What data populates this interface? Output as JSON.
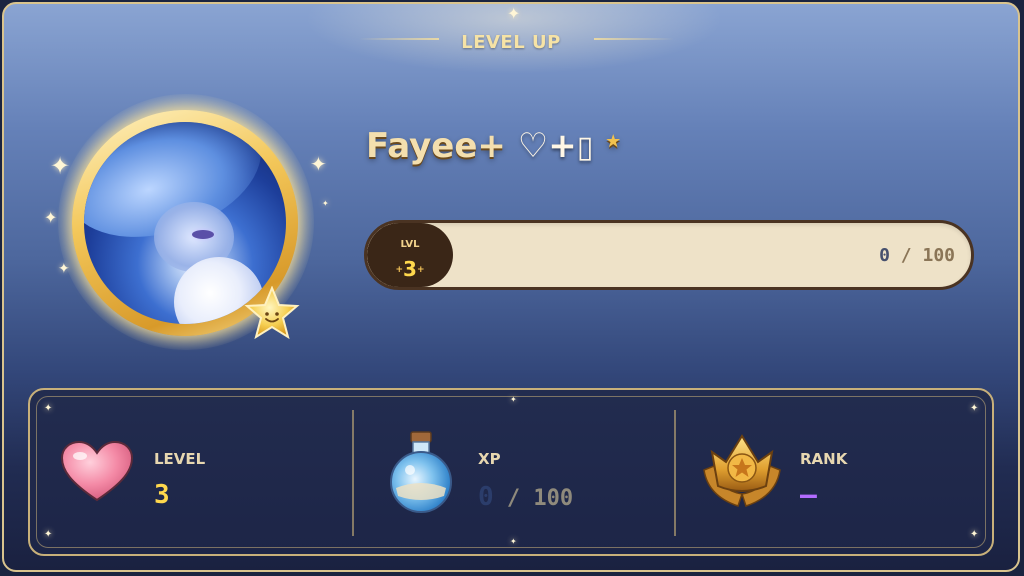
{
  "banner": {
    "title": "LEVEL UP"
  },
  "profile": {
    "name": "Fayee+",
    "name_suffix": " ♡+",
    "name_box": "▯",
    "name_star": "★"
  },
  "xp_bar": {
    "level_label": "LVL",
    "level_value": "3",
    "current": "0",
    "separator": " / ",
    "max": "100",
    "progress_fraction": 0.0
  },
  "stats": {
    "level": {
      "title": "LEVEL",
      "value": "3",
      "icon": "heart-icon"
    },
    "xp": {
      "title": "XP",
      "current": "0",
      "separator": " / ",
      "max": "100",
      "icon": "potion-icon"
    },
    "rank": {
      "title": "RANK",
      "value": "—",
      "icon": "crown-badge-icon"
    }
  },
  "colors": {
    "gold": "#f4dfae",
    "level_value": "#ffd84d",
    "rank_value": "#b26cff",
    "xp_current": "#2b3d6b",
    "xp_max": "#8f8a7c"
  }
}
